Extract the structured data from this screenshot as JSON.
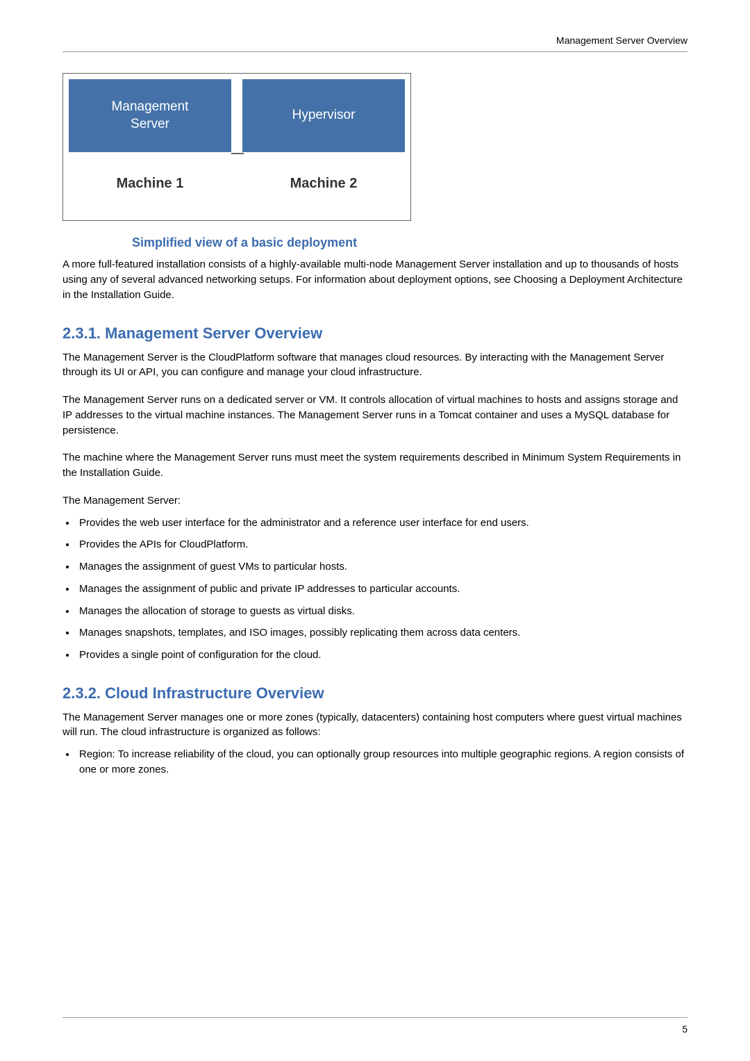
{
  "header": {
    "title": "Management Server Overview"
  },
  "diagram": {
    "machine1": {
      "top": "Management\nServer",
      "bottom": "Machine 1"
    },
    "machine2": {
      "top": "Hypervisor",
      "bottom": "Machine 2"
    },
    "caption": "Simplified view of a basic deployment"
  },
  "intro": "A more full-featured installation consists of a highly-available multi-node Management Server installation and up to thousands of hosts using any of several advanced networking setups. For information about deployment options, see Choosing a Deployment Architecture in the Installation Guide.",
  "section1": {
    "heading": "2.3.1. Management Server Overview",
    "p1": "The Management Server is the CloudPlatform software that manages cloud resources. By interacting with the Management Server through its UI or API, you can configure and manage your cloud infrastructure.",
    "p2": "The Management Server runs on a dedicated server or VM. It controls allocation of virtual machines to hosts and assigns storage and IP addresses to the virtual machine instances. The Management Server runs in a Tomcat container and uses a MySQL database for persistence.",
    "p3": "The machine where the Management Server runs must meet the system requirements described in Minimum System Requirements in the Installation Guide.",
    "p4": "The Management Server:",
    "bullets": [
      "Provides the web user interface for the administrator and a reference user interface for end users.",
      "Provides the APIs for CloudPlatform.",
      "Manages the assignment of guest VMs to particular hosts.",
      "Manages the assignment of public and private IP addresses to particular accounts.",
      "Manages the allocation of storage to guests as virtual disks.",
      "Manages snapshots, templates, and ISO images, possibly replicating them across data centers.",
      "Provides a single point of configuration for the cloud."
    ]
  },
  "section2": {
    "heading": "2.3.2. Cloud Infrastructure Overview",
    "p1": "The Management Server manages one or more zones (typically, datacenters) containing host computers where guest virtual machines will run. The cloud infrastructure is organized as follows:",
    "bullets": [
      "Region: To increase reliability of the cloud, you can optionally group resources into multiple geographic regions. A region consists of one or more zones."
    ]
  },
  "footer": {
    "page": "5"
  }
}
